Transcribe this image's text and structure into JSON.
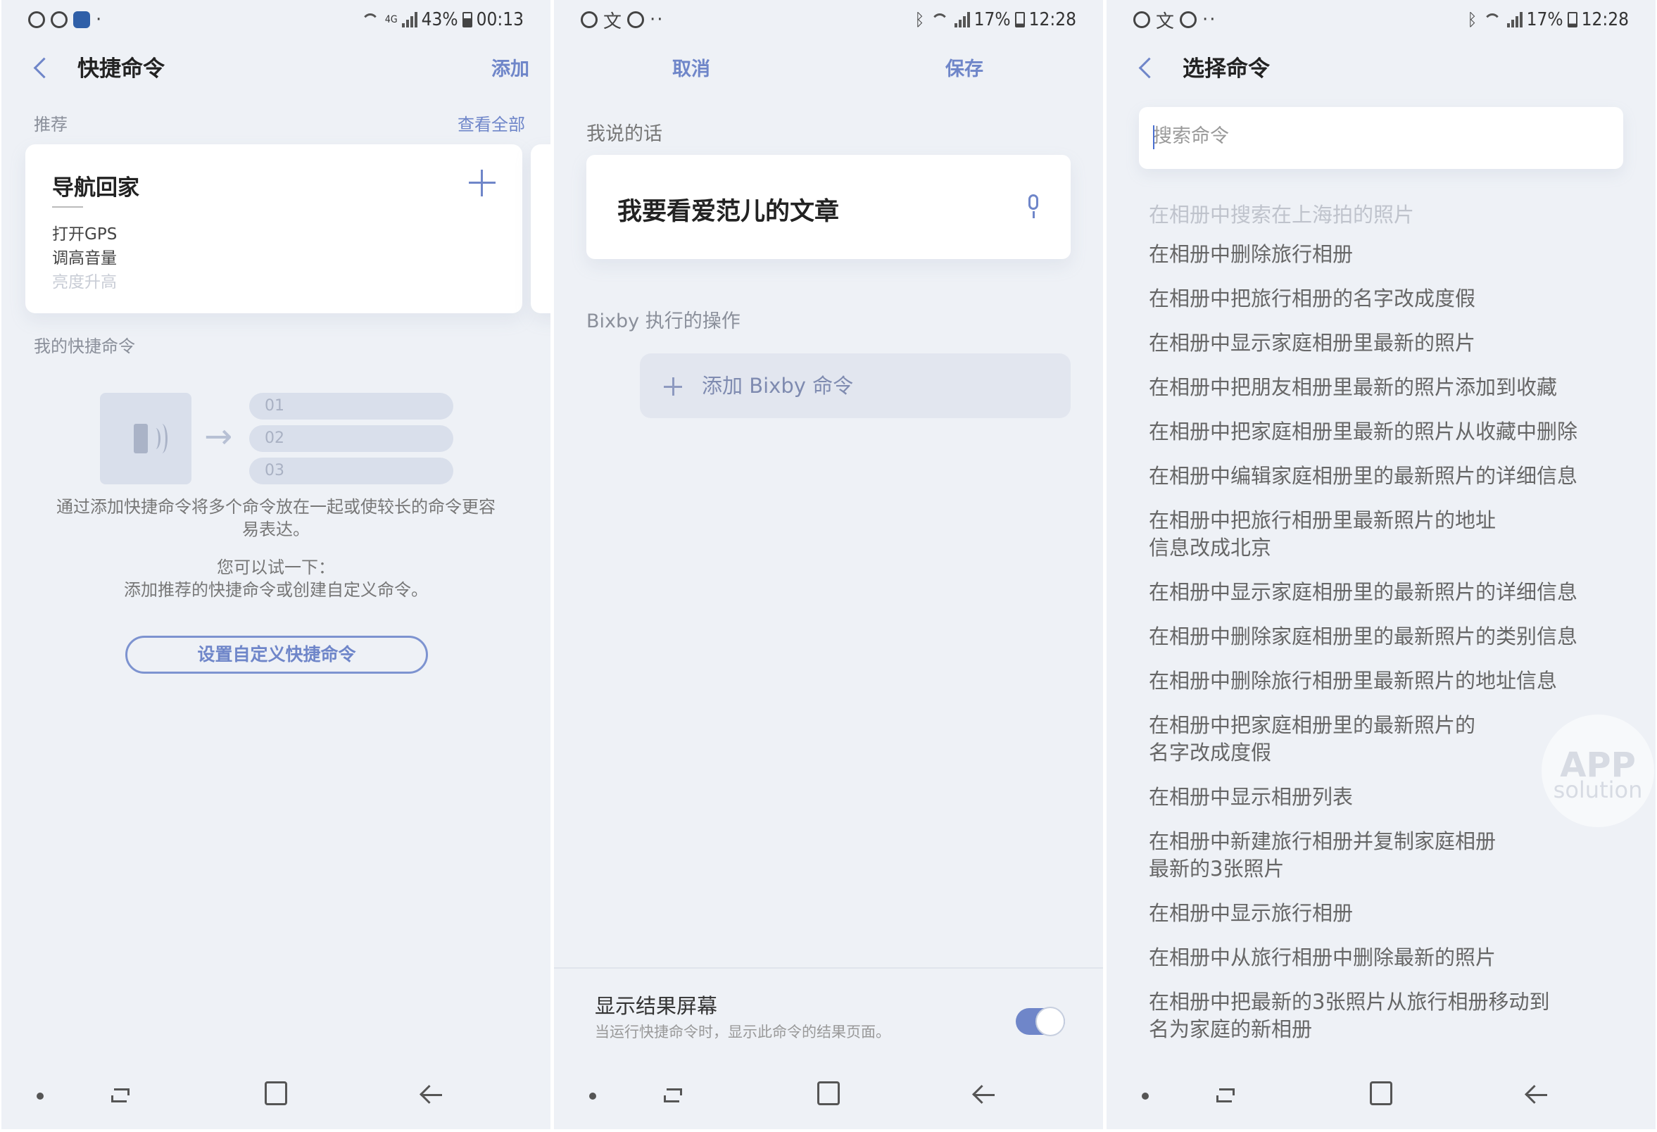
{
  "panel1": {
    "status": {
      "battery": "43%",
      "time": "00:13",
      "network": "4G"
    },
    "header": {
      "title": "快捷命令",
      "action": "添加"
    },
    "recommended": {
      "label": "推荐",
      "see_all": "查看全部",
      "card": {
        "title": "导航回家",
        "lines": [
          "打开GPS",
          "调高音量",
          "亮度升高"
        ]
      }
    },
    "my_shortcuts": {
      "label": "我的快捷命令",
      "rows": [
        "01",
        "02",
        "03"
      ],
      "description": "通过添加快捷命令将多个命令放在一起或使较长的命令更容易表达。",
      "try_title": "您可以试一下：",
      "try_text": "添加推荐的快捷命令或创建自定义命令。",
      "button": "设置自定义快捷命令"
    }
  },
  "panel2": {
    "status": {
      "battery": "17%",
      "time": "12:28"
    },
    "header": {
      "cancel": "取消",
      "save": "保存"
    },
    "say_label": "我说的话",
    "say_text": "我要看爱范儿的文章",
    "bixby_label": "Bixby 执行的操作",
    "add_command": "添加 Bixby 命令",
    "result_screen": {
      "title": "显示结果屏幕",
      "subtitle": "当运行快捷命令时，显示此命令的结果页面。",
      "enabled": true
    }
  },
  "panel3": {
    "status": {
      "battery": "17%",
      "time": "12:28"
    },
    "header": {
      "title": "选择命令"
    },
    "search": {
      "placeholder": "搜索命令",
      "value": ""
    },
    "faded_item": "在相册中搜索在上海拍的照片",
    "commands": [
      "在相册中删除旅行相册",
      "在相册中把旅行相册的名字改成度假",
      "在相册中显示家庭相册里最新的照片",
      "在相册中把朋友相册里最新的照片添加到收藏",
      "在相册中把家庭相册里最新的照片从收藏中删除",
      "在相册中编辑家庭相册里的最新照片的详细信息",
      [
        "在相册中把旅行相册里最新照片的地址",
        "信息改成北京"
      ],
      "在相册中显示家庭相册里的最新照片的详细信息",
      "在相册中删除家庭相册里的最新照片的类别信息",
      "在相册中删除旅行相册里最新照片的地址信息",
      [
        "在相册中把家庭相册里的最新照片的",
        "名字改成度假"
      ],
      "在相册中显示相册列表",
      [
        "在相册中新建旅行相册并复制家庭相册",
        "最新的3张照片"
      ],
      "在相册中显示旅行相册",
      "在相册中从旅行相册中删除最新的照片",
      [
        "在相册中把最新的3张照片从旅行相册移动到",
        "名为家庭的新相册"
      ]
    ],
    "watermark": {
      "line1": "APP",
      "line2": "solution"
    }
  },
  "colors": {
    "accent": "#6f86c9",
    "background": "#eef1f6",
    "card": "#ffffff"
  }
}
